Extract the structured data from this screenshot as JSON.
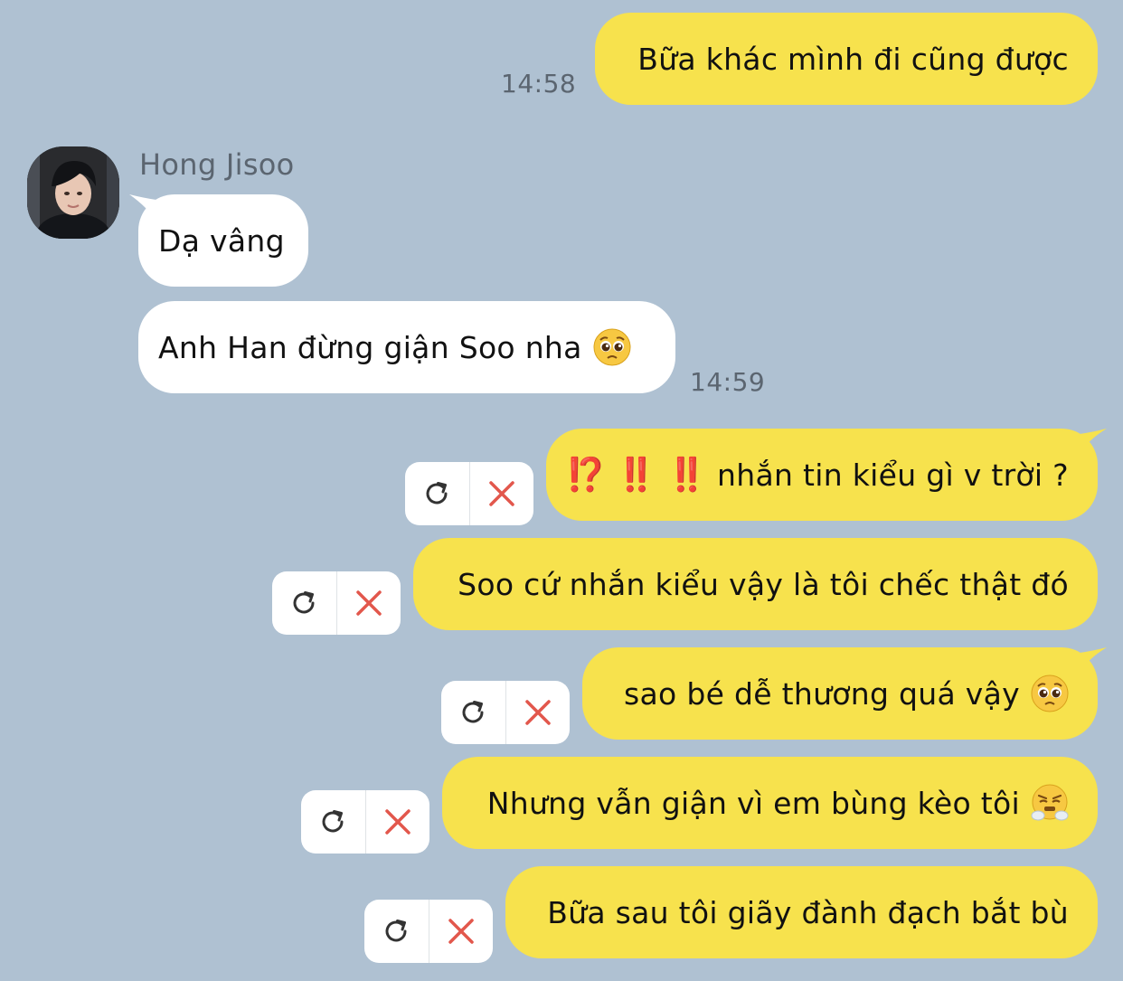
{
  "contact": {
    "name": "Hong Jisoo"
  },
  "messages": {
    "m1": {
      "text": "Bữa khác mình đi cũng được",
      "time": "14:58"
    },
    "m2": {
      "text": "Dạ vâng"
    },
    "m3": {
      "text": "Anh Han đừng giận Soo nha",
      "emoji": "pleading-face-emoji",
      "time": "14:59"
    },
    "m4": {
      "marks": [
        "⁉️",
        "‼️",
        "‼️"
      ],
      "text": "nhắn tin kiểu gì v trời ?"
    },
    "m5": {
      "text": "Soo cứ nhắn kiểu vậy là tôi chếc thật đó"
    },
    "m6": {
      "text": "sao bé dễ thương quá vậy",
      "emoji": "pleading-face-emoji"
    },
    "m7": {
      "text": "Nhưng vẫn giận vì em bùng kèo tôi",
      "emoji": "face-with-steam-from-nose-emoji"
    },
    "m8": {
      "text": "Bữa sau tôi giãy đành đạch bắt bù"
    }
  },
  "failed_actions": {
    "retry_icon": "retry-icon",
    "delete_icon": "close-icon"
  },
  "colors": {
    "background": "#afc1d2",
    "my_bubble": "#f7e24d",
    "their_bubble": "#ffffff",
    "delete_red": "#e2574c",
    "timestamp": "#5b6570"
  }
}
